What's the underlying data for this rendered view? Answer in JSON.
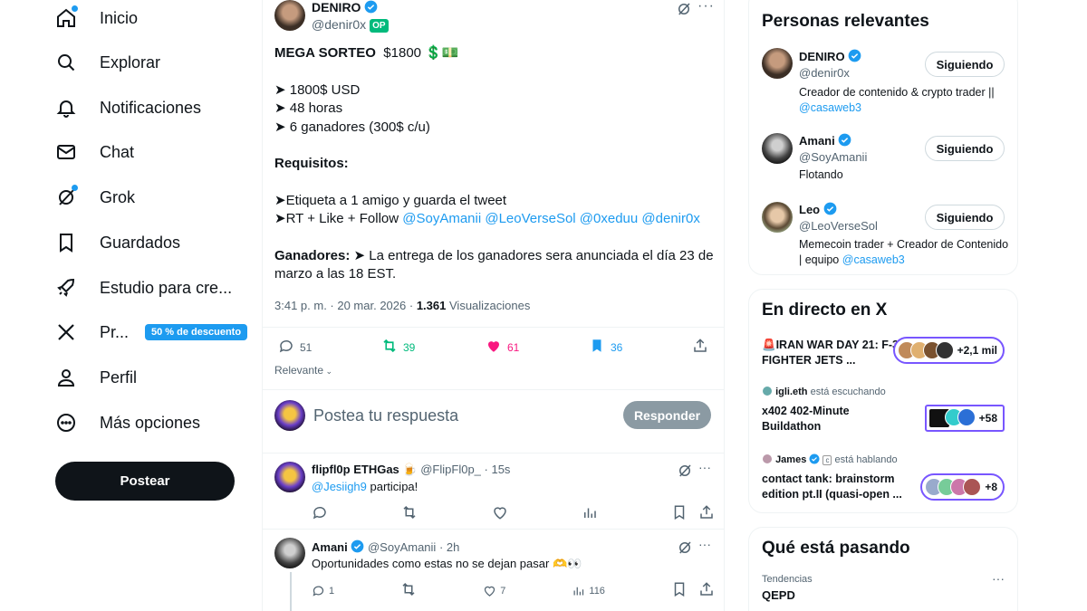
{
  "nav": {
    "items": [
      {
        "label": "Inicio",
        "icon": "home-icon"
      },
      {
        "label": "Explorar",
        "icon": "search-icon"
      },
      {
        "label": "Notificaciones",
        "icon": "bell-icon"
      },
      {
        "label": "Chat",
        "icon": "mail-icon"
      },
      {
        "label": "Grok",
        "icon": "grok-icon"
      },
      {
        "label": "Guardados",
        "icon": "bookmark-icon"
      },
      {
        "label": "Estudio para cre...",
        "icon": "rocket-icon"
      },
      {
        "label": "Pr...",
        "icon": "x-logo-icon"
      },
      {
        "label": "Perfil",
        "icon": "person-icon"
      },
      {
        "label": "Más opciones",
        "icon": "more-circle-icon"
      }
    ],
    "premium_badge": "50 % de descuento",
    "post_button": "Postear"
  },
  "tweet": {
    "author_name": "DENIRO",
    "author_handle": "@denir0x",
    "op_badge": "OP",
    "title_bold": "MEGA SORTEO",
    "title_amount": "$1800 💲💵",
    "lines": [
      "➤ 1800$ USD",
      "➤ 48 horas",
      "➤ 6 ganadores (300$ c/u)"
    ],
    "requisitos_label": "Requisitos:",
    "req_line1": "➤Etiqueta a 1 amigo y guarda el tweet",
    "req_line2_prefix": "➤RT + Like + Follow",
    "req_mentions": "@SoyAmanii @LeoVerseSol @0xeduu @denir0x",
    "ganadores_label": "Ganadores:",
    "ganadores_text": "➤ La entrega de los ganadores sera anunciada el día 23 de marzo a las 18 EST.",
    "timestamp": "3:41 p. m. · 20 mar. 2026 ·",
    "views_count": "1.361",
    "views_label": "Visualizaciones",
    "replies": "51",
    "retweets": "39",
    "likes": "61",
    "bookmarks": "36",
    "sort_label": "Relevante",
    "reply_placeholder": "Postea tu respuesta",
    "reply_button": "Responder",
    "colors": {
      "retweet": "#00ba7c",
      "like": "#f91880",
      "bookmark": "#1d9bf0"
    }
  },
  "replies": [
    {
      "name": "flipfl0p ETHGas",
      "emoji": "🍺",
      "handle": "@FlipFl0p_",
      "time": "· 15s",
      "mention": "@Jesiigh9",
      "text": " participa!",
      "likes": "",
      "views": "",
      "reply_count": ""
    },
    {
      "name": "Amani",
      "handle": "@SoyAmanii",
      "time": "· 2h",
      "text": "Oportunidades como estas no se dejan pasar 🫶👀",
      "reply_count": "1",
      "likes": "7",
      "views": "116"
    }
  ],
  "relevant": {
    "title": "Personas relevantes",
    "people": [
      {
        "name": "DENIRO",
        "handle": "@denir0x",
        "bio": "Creador de contenido & crypto trader ||",
        "bio_link": "@casaweb3",
        "button": "Siguiendo"
      },
      {
        "name": "Amani",
        "handle": "@SoyAmanii",
        "bio": "Flotando",
        "bio_link": "",
        "button": "Siguiendo"
      },
      {
        "name": "Leo",
        "handle": "@LeoVerseSol",
        "bio": "Memecoin trader + Creador de Contenido | equipo",
        "bio_link": "@casaweb3",
        "button": "Siguiendo"
      }
    ]
  },
  "live": {
    "title": "En directo en X",
    "spaces": [
      {
        "host": "",
        "status": "",
        "title": "🚨IRAN WAR DAY 21: F-35 FIGHTER JETS ...",
        "count": "+2,1 mil"
      },
      {
        "host": "igli.eth",
        "status": "está escuchando",
        "title": "x402 402-Minute Buildathon",
        "count": "+58"
      },
      {
        "host": "James",
        "status": "está hablando",
        "title": "contact tank: brainstorm edition pt.II (quasi-open ...",
        "count": "+8"
      }
    ]
  },
  "trending": {
    "title": "Qué está pasando",
    "label": "Tendencias",
    "topic": "QEPD"
  }
}
